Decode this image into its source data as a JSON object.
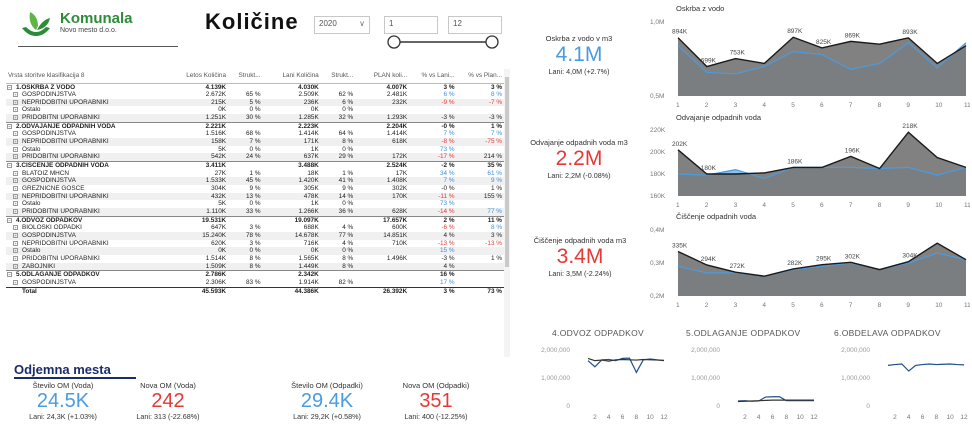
{
  "header": {
    "brand": "Komunala",
    "brand_sub": "Novo mesto d.o.o.",
    "title": "Količine",
    "year": "2020",
    "month_from": "1",
    "month_to": "12"
  },
  "table": {
    "columns": [
      "Vrsta storitve klasifikacija 8",
      "Letos Količina",
      "Strukt...",
      "Lani Količina",
      "Strukt...",
      "PLAN koli...",
      "% vs Lani...",
      "% vs Plan..."
    ],
    "rows": [
      {
        "t": "g",
        "c": [
          "1.OSKRBA Z VODO",
          "4.139K",
          "",
          "4.030K",
          "",
          "4.007K",
          "3 %",
          "3 %"
        ]
      },
      {
        "t": "r",
        "c": [
          "GOSPODINJSTVA",
          "2.672K",
          "65 %",
          "2.509K",
          "62 %",
          "2.481K",
          "6 %",
          "8 %"
        ],
        "d": [
          "pos",
          "pos"
        ]
      },
      {
        "t": "r",
        "c": [
          "NEPRIDOBITNI UPORABNIKI",
          "215K",
          "5 %",
          "236K",
          "6 %",
          "232K",
          "-9 %",
          "-7 %"
        ],
        "d": [
          "neg",
          "neg"
        ]
      },
      {
        "t": "r",
        "c": [
          "Ostalo",
          "0K",
          "0 %",
          "0K",
          "0 %",
          "",
          "",
          ""
        ]
      },
      {
        "t": "r",
        "c": [
          "PRIDOBITNI UPORABNIKI",
          "1.251K",
          "30 %",
          "1.285K",
          "32 %",
          "1.293K",
          "-3 %",
          "-3 %"
        ]
      },
      {
        "t": "g",
        "c": [
          "2.ODVAJANJE ODPADNIH VODA",
          "2.221K",
          "",
          "2.223K",
          "",
          "2.204K",
          "-0 %",
          "1 %"
        ]
      },
      {
        "t": "r",
        "c": [
          "GOSPODINJSTVA",
          "1.516K",
          "68 %",
          "1.414K",
          "64 %",
          "1.414K",
          "7 %",
          "7 %"
        ],
        "d": [
          "pos",
          "pos"
        ]
      },
      {
        "t": "r",
        "c": [
          "NEPRIDOBITNI UPORABNIKI",
          "158K",
          "7 %",
          "171K",
          "8 %",
          "618K",
          "-8 %",
          "-75 %"
        ],
        "d": [
          "neg",
          "neg"
        ]
      },
      {
        "t": "r",
        "c": [
          "Ostalo",
          "5K",
          "0 %",
          "1K",
          "0 %",
          "",
          "73 %",
          ""
        ],
        "d": [
          "pos",
          ""
        ]
      },
      {
        "t": "r",
        "c": [
          "PRIDOBITNI UPORABNIKI",
          "542K",
          "24 %",
          "637K",
          "29 %",
          "172K",
          "-17 %",
          "214 %"
        ],
        "d": [
          "neg",
          ""
        ]
      },
      {
        "t": "g",
        "c": [
          "3.ČIŠČENJE ODPADNIH VODA",
          "3.411K",
          "",
          "3.488K",
          "",
          "2.524K",
          "-2 %",
          "35 %"
        ]
      },
      {
        "t": "r",
        "c": [
          "BLATOIZ MHČN",
          "27K",
          "1 %",
          "18K",
          "1 %",
          "17K",
          "34 %",
          "61 %"
        ],
        "d": [
          "pos",
          "pos"
        ]
      },
      {
        "t": "r",
        "c": [
          "GOSPODINJSTVA",
          "1.533K",
          "45 %",
          "1.420K",
          "41 %",
          "1.408K",
          "7 %",
          "9 %"
        ],
        "d": [
          "pos",
          "pos"
        ]
      },
      {
        "t": "r",
        "c": [
          "GREZNIČNE GOŠČE",
          "304K",
          "9 %",
          "305K",
          "9 %",
          "302K",
          "-0 %",
          "1 %"
        ]
      },
      {
        "t": "r",
        "c": [
          "NEPRIDOBITNI UPORABNIKI",
          "432K",
          "13 %",
          "478K",
          "14 %",
          "170K",
          "-11 %",
          "155 %"
        ],
        "d": [
          "neg",
          ""
        ]
      },
      {
        "t": "r",
        "c": [
          "Ostalo",
          "5K",
          "0 %",
          "1K",
          "0 %",
          "",
          "73 %",
          ""
        ],
        "d": [
          "pos",
          ""
        ]
      },
      {
        "t": "r",
        "c": [
          "PRIDOBITNI UPORABNIKI",
          "1.110K",
          "33 %",
          "1.266K",
          "36 %",
          "628K",
          "-14 %",
          "77 %"
        ],
        "d": [
          "neg",
          "pos"
        ]
      },
      {
        "t": "g",
        "c": [
          "4.ODVOZ ODPADKOV",
          "19.531K",
          "",
          "19.097K",
          "",
          "17.657K",
          "2 %",
          "11 %"
        ]
      },
      {
        "t": "r",
        "c": [
          "BIOLOŠKI ODPADKI",
          "647K",
          "3 %",
          "688K",
          "4 %",
          "600K",
          "-6 %",
          "8 %"
        ],
        "d": [
          "neg",
          "pos"
        ]
      },
      {
        "t": "r",
        "c": [
          "GOSPODINJSTVA",
          "15.240K",
          "78 %",
          "14.678K",
          "77 %",
          "14.851K",
          "4 %",
          "3 %"
        ]
      },
      {
        "t": "r",
        "c": [
          "NEPRIDOBITNI UPORABNIKI",
          "620K",
          "3 %",
          "716K",
          "4 %",
          "710K",
          "-13 %",
          "-13 %"
        ],
        "d": [
          "neg",
          "neg"
        ]
      },
      {
        "t": "r",
        "c": [
          "Ostalo",
          "0K",
          "0 %",
          "0K",
          "0 %",
          "",
          "15 %",
          ""
        ],
        "d": [
          "pos",
          ""
        ]
      },
      {
        "t": "r",
        "c": [
          "PRIDOBITNI UPORABNIKI",
          "1.514K",
          "8 %",
          "1.565K",
          "8 %",
          "1.496K",
          "-3 %",
          "1 %"
        ]
      },
      {
        "t": "r",
        "c": [
          "ZABOJNIKI",
          "1.509K",
          "8 %",
          "1.449K",
          "8 %",
          "",
          "4 %",
          ""
        ]
      },
      {
        "t": "g",
        "c": [
          "5.ODLAGANJE ODPADKOV",
          "2.786K",
          "",
          "2.342K",
          "",
          "",
          "16 %",
          ""
        ]
      },
      {
        "t": "r",
        "c": [
          "GOSPODINJSTVA",
          "2.306K",
          "83 %",
          "1.914K",
          "82 %",
          "",
          "17 %",
          ""
        ],
        "d": [
          "pos",
          ""
        ]
      },
      {
        "t": "tot",
        "c": [
          "Total",
          "45.593K",
          "",
          "44.386K",
          "",
          "26.392K",
          "3 %",
          "73 %"
        ]
      }
    ]
  },
  "section_title": "Odjemna mesta",
  "kpis": [
    {
      "label": "Število OM (Voda)",
      "value": "24.5K",
      "prev": "Lani: 24,3K (+1.03%)",
      "color": "blue"
    },
    {
      "label": "Nova OM (Voda)",
      "value": "242",
      "prev": "Lani: 313 (-22.68%)",
      "color": "red"
    },
    {
      "label": "Število OM (Odpadki)",
      "value": "29.4K",
      "prev": "Lani: 29,2K (+0.58%)",
      "color": "blue"
    },
    {
      "label": "Nova OM (Odpadki)",
      "value": "351",
      "prev": "Lani: 400 (-12.25%)",
      "color": "red"
    }
  ],
  "right_kpis": [
    {
      "label": "Oskrba z vodo v m3",
      "value": "4.1M",
      "prev": "Lani: 4,0M (+2.7%)",
      "color": "blue"
    },
    {
      "label": "Odvajanje odpadnih voda m3",
      "value": "2.2M",
      "prev": "Lani: 2,2M (-0.08%)",
      "color": "red"
    },
    {
      "label": "Čiščenje odpadnih voda m3",
      "value": "3.4M",
      "prev": "Lani: 3,5M (-2.24%)",
      "color": "red"
    }
  ],
  "colors": {
    "blue": "#4a9be0",
    "red": "#e53935",
    "dark": "#5b5b5b",
    "light_blue": "#7fb8ec",
    "grey_area": "#7a7a7a"
  },
  "chart_data": [
    {
      "type": "area",
      "title": "Oskrba z vodo",
      "x": [
        1,
        2,
        3,
        4,
        5,
        6,
        7,
        8,
        9,
        10,
        11
      ],
      "ylim": [
        0.5,
        1.0
      ],
      "yticks": [
        "1,0M",
        "0,5M"
      ],
      "series": [
        {
          "values": [
            0.894,
            0.699,
            0.753,
            0.72,
            0.897,
            0.825,
            0.869,
            0.85,
            0.893,
            0.72,
            0.84
          ]
        },
        {
          "values": [
            0.84,
            0.66,
            0.65,
            0.7,
            0.8,
            0.78,
            0.68,
            0.72,
            0.86,
            0.69,
            0.86
          ]
        }
      ],
      "data_labels": [
        "894K",
        "699K",
        "753K",
        "",
        "897K",
        "825K",
        "869K",
        "",
        "893K",
        "",
        ""
      ]
    },
    {
      "type": "area",
      "title": "Odvajanje odpadnih voda",
      "x": [
        1,
        2,
        3,
        4,
        5,
        6,
        7,
        8,
        9,
        10,
        11
      ],
      "ylim": [
        160,
        220
      ],
      "yticks": [
        "220K",
        "200K",
        "180K",
        "160K"
      ],
      "series": [
        {
          "values": [
            202,
            180,
            180,
            181,
            186,
            186,
            196,
            185,
            218,
            195,
            186
          ]
        },
        {
          "values": [
            180,
            179,
            184,
            176,
            186,
            186,
            186,
            185,
            186,
            179,
            186
          ]
        }
      ],
      "data_labels": [
        "202K",
        "180K",
        "",
        "",
        "186K",
        "",
        "196K",
        "",
        "218K",
        "",
        ""
      ]
    },
    {
      "type": "area",
      "title": "Čiščenje odpadnih voda",
      "x": [
        1,
        2,
        3,
        4,
        5,
        6,
        7,
        8,
        9,
        10,
        11
      ],
      "ylim": [
        0.2,
        0.4
      ],
      "yticks": [
        "0,4M",
        "0,3M",
        "0,2M"
      ],
      "series": [
        {
          "values": [
            0.335,
            0.294,
            0.272,
            0.26,
            0.282,
            0.295,
            0.302,
            0.28,
            0.304,
            0.36,
            0.31
          ]
        },
        {
          "values": [
            0.29,
            0.27,
            0.27,
            0.26,
            0.28,
            0.29,
            0.3,
            0.28,
            0.3,
            0.33,
            0.31
          ]
        }
      ],
      "data_labels": [
        "335K",
        "294K",
        "272K",
        "",
        "282K",
        "295K",
        "302K",
        "",
        "304K",
        "",
        ""
      ]
    },
    {
      "type": "line",
      "title": "4.ODVOZ ODPADKOV",
      "x": [
        1,
        2,
        3,
        4,
        5,
        6,
        7,
        8,
        9,
        10,
        11,
        12
      ],
      "ylim": [
        0,
        2000000
      ],
      "yticks": [
        "2,000,000",
        "1,000,000",
        "0"
      ],
      "xticks": [
        "2",
        "4",
        "6",
        "8",
        "10",
        "12"
      ],
      "series": [
        {
          "values": [
            1620000,
            1400000,
            1650000,
            1660000,
            1620000,
            1700000,
            1710000,
            1200000,
            1650000,
            1680000,
            1650000,
            1620000
          ]
        },
        {
          "values": [
            1700000,
            1620000,
            1640000,
            1600000,
            1650000,
            1660000,
            1650000,
            1640000,
            1660000,
            1650000,
            1640000,
            1630000
          ]
        }
      ]
    },
    {
      "type": "line",
      "title": "5.ODLAGANJE ODPADKOV",
      "x": [
        1,
        2,
        3,
        4,
        5,
        6,
        7,
        8,
        9,
        10,
        11,
        12
      ],
      "ylim": [
        0,
        2000000
      ],
      "yticks": [
        "2,000,000",
        "1,000,000",
        "0"
      ],
      "xticks": [
        "2",
        "4",
        "6",
        "8",
        "10",
        "12"
      ],
      "series": [
        {
          "values": [
            180000,
            190000,
            170000,
            180000,
            320000,
            330000,
            330000,
            190000,
            190000,
            190000,
            190000,
            190000
          ]
        },
        {
          "values": [
            160000,
            170000,
            180000,
            190000,
            200000,
            210000,
            210000,
            210000,
            210000,
            210000,
            210000,
            210000
          ]
        }
      ]
    },
    {
      "type": "line",
      "title": "6.OBDELAVA ODPADKOV",
      "x": [
        1,
        2,
        3,
        4,
        5,
        6,
        7,
        8,
        9,
        10,
        11,
        12
      ],
      "ylim": [
        0,
        2000000
      ],
      "yticks": [
        "2,000,000",
        "1,000,000",
        "0"
      ],
      "xticks": [
        "2",
        "4",
        "6",
        "8",
        "10",
        "12"
      ],
      "series": [
        {
          "values": [
            1450000,
            1480000,
            1500000,
            1250000,
            1450000,
            1480000,
            1500000,
            1480000,
            1490000,
            1500000,
            1480000,
            1470000
          ]
        }
      ]
    }
  ]
}
